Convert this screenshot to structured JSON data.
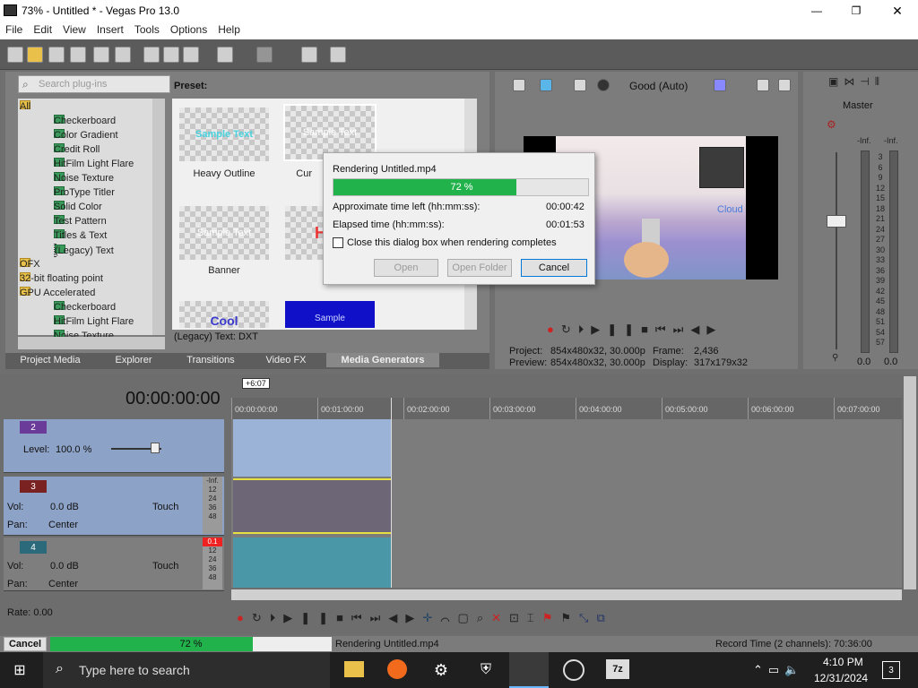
{
  "window": {
    "title": "73% - Untitled * - Vegas Pro 13.0",
    "minimize": "—",
    "maximize": "❐",
    "close": "✕"
  },
  "menu": [
    "File",
    "Edit",
    "View",
    "Insert",
    "Tools",
    "Options",
    "Help"
  ],
  "plugin_panel": {
    "search_placeholder": "Search plug-ins",
    "preset_label": "Preset:",
    "tree": [
      {
        "label": "All",
        "kind": "folder",
        "expand": "−"
      },
      {
        "label": "Checkerboard",
        "kind": "gen"
      },
      {
        "label": "Color Gradient",
        "kind": "gen"
      },
      {
        "label": "Credit Roll",
        "kind": "gen"
      },
      {
        "label": "HitFilm Light Flare",
        "kind": "gen"
      },
      {
        "label": "Noise Texture",
        "kind": "gen"
      },
      {
        "label": "ProType Titler",
        "kind": "gen"
      },
      {
        "label": "Solid Color",
        "kind": "gen"
      },
      {
        "label": "Test Pattern",
        "kind": "gen"
      },
      {
        "label": "Titles & Text",
        "kind": "gen"
      },
      {
        "label": "(Legacy) Text",
        "kind": "gen"
      },
      {
        "label": "OFX",
        "kind": "folder",
        "expand": "+"
      },
      {
        "label": "32-bit floating point",
        "kind": "folder",
        "expand": "+"
      },
      {
        "label": "GPU Accelerated",
        "kind": "folder",
        "expand": "−"
      },
      {
        "label": "Checkerboard",
        "kind": "gen"
      },
      {
        "label": "HitFilm Light Flare",
        "kind": "gen"
      },
      {
        "label": "Noise Texture",
        "kind": "gen"
      }
    ],
    "presets": [
      {
        "label": "Heavy Outline",
        "sample": "Sample Text"
      },
      {
        "label": "Cur",
        "sample": "Sample Text"
      },
      {
        "label": "Banner",
        "sample": "Sample Text"
      },
      {
        "label": "",
        "sample": "H"
      },
      {
        "label": "",
        "sample": "Cool"
      },
      {
        "label": "",
        "sample": "Sample"
      }
    ],
    "status": "(Legacy) Text: DXT",
    "tabs": [
      "Project Media",
      "Explorer",
      "Transitions",
      "Video FX",
      "Media Generators"
    ]
  },
  "render_dialog": {
    "title": "Rendering Untitled.mp4",
    "progress_text": "72 %",
    "progress": 0.72,
    "time_left_label": "Approximate time left (hh:mm:ss):",
    "time_left_value": "00:00:42",
    "elapsed_label": "Elapsed time (hh:mm:ss):",
    "elapsed_value": "00:01:53",
    "checkbox_label": "Close this dialog box when rendering completes",
    "checkbox_checked": false,
    "open_button": "Open",
    "open_folder_button": "Open Folder",
    "cancel_button": "Cancel"
  },
  "preview": {
    "quality": "Good (Auto)",
    "clip_text": "Cloud",
    "project_label": "Project:",
    "project_value": "854x480x32, 30.000p",
    "preview_label": "Preview:",
    "preview_value": "854x480x32, 30.000p",
    "frame_label": "Frame:",
    "frame_value": "2,436",
    "display_label": "Display:",
    "display_value": "317x179x32"
  },
  "master": {
    "label": "Master",
    "left_peak": "-Inf.",
    "right_peak": "-Inf.",
    "scale": [
      "3",
      "6",
      "9",
      "12",
      "15",
      "18",
      "21",
      "24",
      "27",
      "30",
      "33",
      "36",
      "39",
      "42",
      "45",
      "48",
      "51",
      "54",
      "57"
    ],
    "left_value": "0.0",
    "right_value": "0.0"
  },
  "timeline": {
    "timecode": "00:00:00:00",
    "marker": "+6:07",
    "ruler": [
      "00:00:00:00",
      "00:01:00:00",
      "00:02:00:00",
      "00:03:00:00",
      "00:04:00:00",
      "00:05:00:00",
      "00:06:00:00",
      "00:07:00:00"
    ],
    "tracks": [
      {
        "number": "2",
        "level_label": "Level:",
        "level_value": "100.0 %"
      },
      {
        "number": "3",
        "vol_label": "Vol:",
        "vol_value": "0.0 dB",
        "pan_label": "Pan:",
        "pan_value": "Center",
        "mode": "Touch",
        "peak": "-Inf.",
        "meter": [
          "12",
          "24",
          "36",
          "48"
        ]
      },
      {
        "number": "4",
        "vol_label": "Vol:",
        "vol_value": "0.0 dB",
        "pan_label": "Pan:",
        "pan_value": "Center",
        "mode": "Touch",
        "peak": "0.1",
        "meter": [
          "12",
          "24",
          "36",
          "48"
        ]
      }
    ],
    "rate": "Rate: 0.00"
  },
  "statusbar": {
    "cancel": "Cancel",
    "progress_text": "72 %",
    "progress": 0.72,
    "rendering": "Rendering Untitled.mp4",
    "record_time": "Record Time (2 channels): 70:36:00"
  },
  "taskbar": {
    "search_placeholder": "Type here to search",
    "time": "4:10 PM",
    "date": "12/31/2024",
    "notification_count": "3"
  },
  "colors": {
    "progress_green": "#22b24c",
    "timeline_bg": "#7c7c7c",
    "video_event": "#9bb3d6",
    "audio_event": "#4a97a8"
  }
}
